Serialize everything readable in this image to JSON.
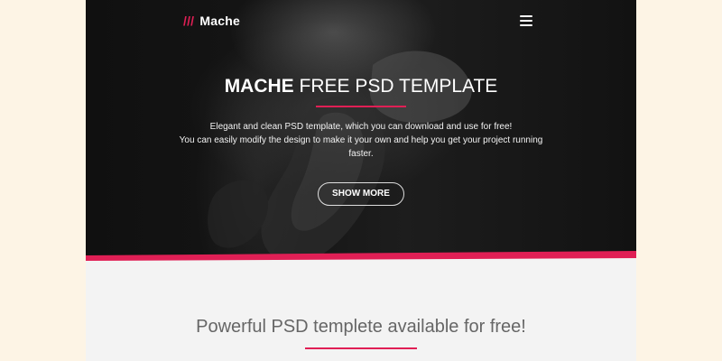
{
  "colors": {
    "page_background": "#fdf4e5",
    "accent": "#e01f55",
    "hero_text": "#ffffff",
    "section_background": "#f3f3f3",
    "section_title": "#666666"
  },
  "header": {
    "brand_slashes": "///",
    "brand_name": "Mache",
    "menu_icon": "hamburger-menu-icon"
  },
  "hero": {
    "title_strong": "MACHE",
    "title_rest": " FREE PSD TEMPLATE",
    "text_line_1": "Elegant and clean PSD template, which you can download and use for free!",
    "text_line_2": "You can easily modify the design to make it your own and help you get your project running",
    "text_line_3": "faster.",
    "button_label": "SHOW MORE"
  },
  "section": {
    "title": "Powerful PSD templete available for free!"
  }
}
